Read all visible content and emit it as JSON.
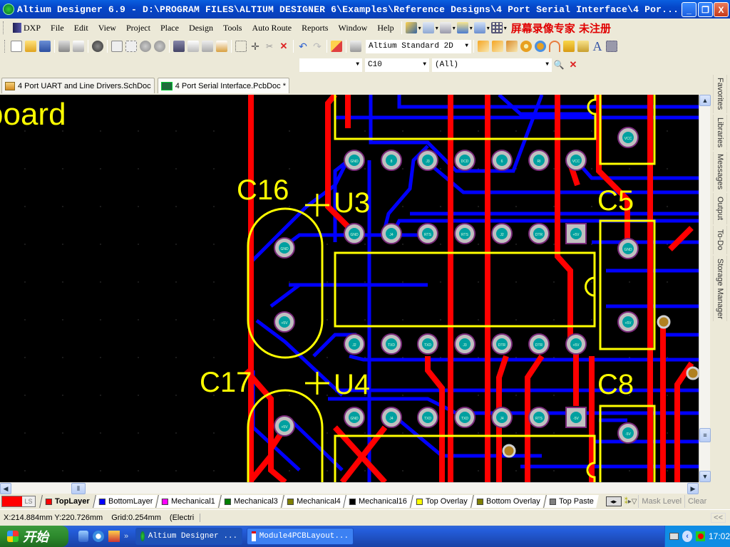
{
  "window": {
    "title": "Altium Designer 6.9 - D:\\PROGRAM FILES\\ALTIUM DESIGNER 6\\Examples\\Reference Designs\\4 Port Serial Interface\\4 Por...",
    "minimize_label": "_",
    "maximize_label": "❐",
    "close_label": "X"
  },
  "menubar": {
    "items": [
      "DXP",
      "File",
      "Edit",
      "View",
      "Project",
      "Place",
      "Design",
      "Tools",
      "Auto Route",
      "Reports",
      "Window",
      "Help"
    ],
    "watermark": "屏幕录像专家 未注册"
  },
  "toolbar": {
    "view_config": "Altium Standard 2D",
    "filter_combo_1": "",
    "component_filter": "C10",
    "net_filter": "(All)"
  },
  "document_tabs": [
    {
      "label": "4 Port UART and Line Drivers.SchDoc",
      "icon": "schematic-doc-icon",
      "active": false
    },
    {
      "label": "4 Port Serial Interface.PcbDoc *",
      "icon": "pcb-doc-icon",
      "active": true
    }
  ],
  "side_panels": [
    "Favorites",
    "Libraries",
    "Messages",
    "Output",
    "To-Do",
    "Storage Manager"
  ],
  "pcb": {
    "board_text": "board",
    "designators": [
      "C16",
      "U3",
      "C5",
      "C17",
      "U4",
      "C8"
    ],
    "colors": {
      "background": "#000000",
      "top_layer": "#ff0000",
      "bottom_layer": "#0000ff",
      "top_overlay": "#ffff00",
      "pad_ring": "#c0c0c0",
      "pad_hole": "#00a0a0",
      "via": "#b08020"
    },
    "u3_pads_top": [
      "GND",
      "8",
      "J3",
      "DCD",
      "6",
      "RI",
      "VCC"
    ],
    "u3_pads_bottom": [
      "GND",
      "J4",
      "RTS",
      "RTS",
      "J2",
      "DTR",
      "+5V"
    ],
    "u4_pads_top": [
      "J2",
      "TXD",
      "TXD",
      "J3",
      "DTR",
      "DTR",
      "+5V"
    ],
    "u4_pads_bottom": [
      "GND",
      "J4",
      "TXD",
      "TXD",
      "J4",
      "RTS",
      "-5V"
    ],
    "c16_pads": [
      "GND",
      "+5V"
    ],
    "c17_pads": [
      "+5V"
    ],
    "c5_pads": [
      "GND",
      "+5V"
    ],
    "c8_pads": [
      "-5V"
    ]
  },
  "layers": {
    "current_swatch": "#ff0000",
    "ls_label": "LS",
    "tabs": [
      {
        "label": "TopLayer",
        "color": "#ff0000",
        "active": true
      },
      {
        "label": "BottomLayer",
        "color": "#0000ff",
        "active": false
      },
      {
        "label": "Mechanical1",
        "color": "#ff00ff",
        "active": false
      },
      {
        "label": "Mechanical3",
        "color": "#008000",
        "active": false
      },
      {
        "label": "Mechanical4",
        "color": "#808000",
        "active": false
      },
      {
        "label": "Mechanical16",
        "color": "#000000",
        "active": false
      },
      {
        "label": "Top Overlay",
        "color": "#ffff00",
        "active": false
      },
      {
        "label": "Bottom Overlay",
        "color": "#808000",
        "active": false
      },
      {
        "label": "Top Paste",
        "color": "#808080",
        "active": false
      }
    ],
    "mask_level_label": "Mask Level",
    "clear_label": "Clear"
  },
  "status": {
    "coords": "X:214.884mm Y:220.726mm",
    "grid": "Grid:0.254mm",
    "mode": "(Electri",
    "collapse_label": "<<"
  },
  "taskbar": {
    "start_label": "开始",
    "tasks": [
      {
        "label": "Altium Designer ...",
        "active": true
      },
      {
        "label": "Module4PCBLayout...",
        "active": false
      }
    ],
    "clock": "17:02"
  }
}
